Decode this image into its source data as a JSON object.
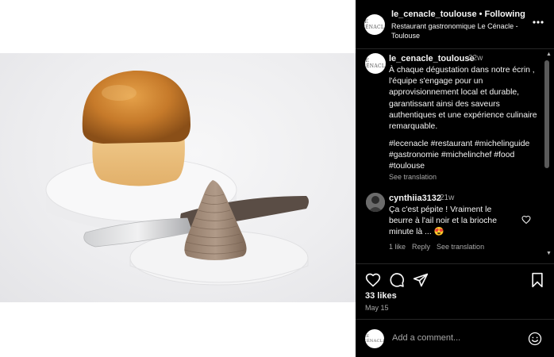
{
  "post": {
    "username": "le_cenacle_toulouse",
    "separator": "•",
    "follow_status": "Following",
    "location": "Restaurant gastronomique Le Cénacle - Toulouse",
    "more_icon": "more-horizontal-icon",
    "avatar_monogram": "LE CÉNACLE"
  },
  "caption": {
    "username": "le_cenacle_toulouse",
    "time": "22w",
    "text": "À chaque dégustation dans notre écrin , l'équipe s'engage pour un approvisionnement local et durable, garantissant ainsi des saveurs authentiques et une expérience culinaire remarquable.",
    "hashtags": "#lecenacle #restaurant #michelinguide #gastronomie #michelinchef #food #toulouse",
    "see_translation": "See translation"
  },
  "comment": {
    "username": "cynthiia3132",
    "time": "21w",
    "text": "Ça c'est pépite ! Vraiment le beurre à l'ail noir et la brioche minute là ... 😍",
    "likes_label": "1 like",
    "reply_label": "Reply",
    "see_translation": "See translation"
  },
  "actions": {
    "like_icon": "heart-icon",
    "comment_icon": "comment-icon",
    "share_icon": "share-icon",
    "save_icon": "bookmark-icon",
    "likes": "33 likes",
    "date": "May 15"
  },
  "add_comment": {
    "placeholder": "Add a comment...",
    "emoji_icon": "emoji-icon"
  },
  "colors": {
    "panel_bg": "#000000",
    "text": "#f5f5f5",
    "secondary_text": "#a8a8a8",
    "divider": "#262626"
  }
}
